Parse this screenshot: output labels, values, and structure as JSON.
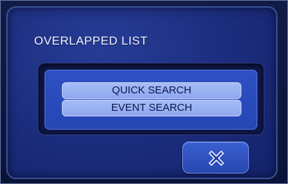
{
  "dialog": {
    "title": "OVERLAPPED LIST",
    "items": [
      {
        "label": "QUICK SEARCH"
      },
      {
        "label": "EVENT SEARCH"
      }
    ],
    "close_icon": "close-x-icon"
  },
  "colors": {
    "dialog_background": "#1b2c7c",
    "list_background": "#2546b3",
    "item_background": "#a6bcf6",
    "item_text": "#0a1650",
    "title_text": "#f2f4ff"
  }
}
